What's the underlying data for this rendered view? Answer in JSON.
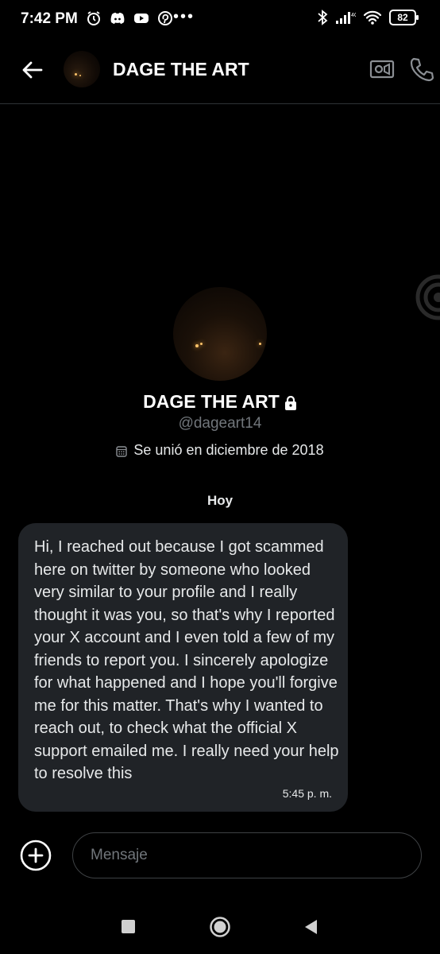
{
  "status_bar": {
    "time": "7:42 PM",
    "left_icons": [
      "alarm-icon",
      "discord-icon",
      "youtube-icon",
      "pinterest-icon"
    ],
    "more": "•••",
    "right_icons": [
      "bluetooth-icon",
      "signal-icon",
      "wifi-icon"
    ],
    "battery": "82"
  },
  "header": {
    "title": "DAGE THE ART",
    "icons": [
      "back-arrow-icon",
      "video-call-icon",
      "phone-icon"
    ]
  },
  "profile": {
    "name": "DAGE THE ART",
    "handle": "@dageart14",
    "joined": "Se unió en diciembre de 2018",
    "protected": true
  },
  "conversation": {
    "day_label": "Hoy",
    "messages": [
      {
        "text": "Hi, I reached out because I got scammed here on twitter by someone who looked very similar to your profile and I really thought it was you, so that's why I reported your X account and I even told a few of my friends to report you. I sincerely apologize for what happened and I hope you'll forgive me for this matter. That's why I wanted to reach out, to check what the official X support emailed me. I really need your help to resolve this",
        "time": "5:45 p. m."
      }
    ]
  },
  "composer": {
    "placeholder": "Mensaje",
    "value": ""
  },
  "colors": {
    "background": "#000000",
    "bubble": "#202327",
    "secondary_text": "#71767b"
  }
}
